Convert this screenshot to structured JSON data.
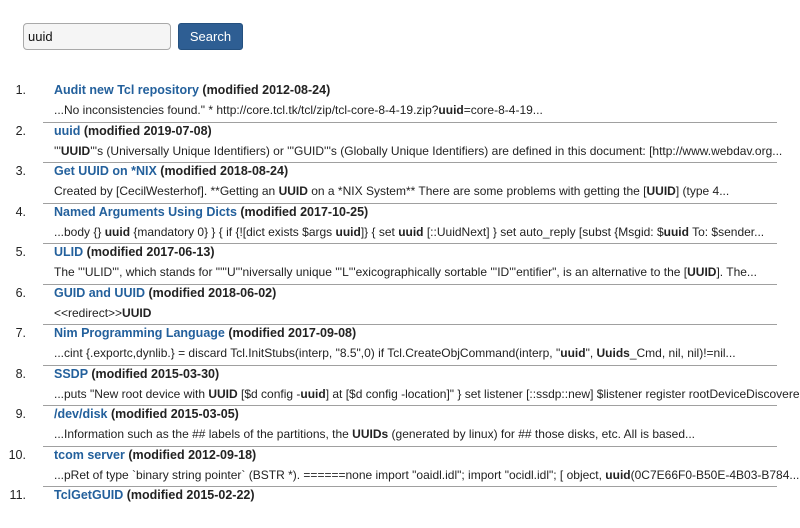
{
  "search": {
    "value": "uuid",
    "button_label": "Search"
  },
  "results": [
    {
      "number": "1.",
      "title": "Audit new Tcl repository",
      "modified": "(modified 2012-08-24)",
      "snippet": [
        {
          "t": "...No inconsistencies found.\" * http://core.tcl.tk/tcl/zip/tcl-core-8-4-19.zip?",
          "b": false
        },
        {
          "t": "uuid",
          "b": true
        },
        {
          "t": "=core-8-4-19...",
          "b": false
        }
      ]
    },
    {
      "number": "2.",
      "title": "uuid",
      "modified": "(modified 2019-07-08)",
      "snippet": [
        {
          "t": "'''",
          "b": false
        },
        {
          "t": "UUID",
          "b": true
        },
        {
          "t": "'''s (Universally Unique Identifiers) or '''GUID'''s (Globally Unique Identifiers) are defined in this document: [http://www.webdav.org...",
          "b": false
        }
      ]
    },
    {
      "number": "3.",
      "title": "Get UUID on *NIX",
      "modified": "(modified 2018-08-24)",
      "snippet": [
        {
          "t": "Created by [CecilWesterhof]. **Getting an ",
          "b": false
        },
        {
          "t": "UUID",
          "b": true
        },
        {
          "t": " on a *NIX System** There are some problems with getting the [",
          "b": false
        },
        {
          "t": "UUID",
          "b": true
        },
        {
          "t": "] (type 4...",
          "b": false
        }
      ]
    },
    {
      "number": "4.",
      "title": "Named Arguments Using Dicts",
      "modified": "(modified 2017-10-25)",
      "snippet": [
        {
          "t": "...body {} ",
          "b": false
        },
        {
          "t": "uuid",
          "b": true
        },
        {
          "t": " {mandatory 0} } { if {![dict exists $args ",
          "b": false
        },
        {
          "t": "uuid",
          "b": true
        },
        {
          "t": "]} { set ",
          "b": false
        },
        {
          "t": "uuid",
          "b": true
        },
        {
          "t": " [::UuidNext] } set auto_reply [subst {Msgid: $",
          "b": false
        },
        {
          "t": "uuid",
          "b": true
        },
        {
          "t": " To: $sender...",
          "b": false
        }
      ]
    },
    {
      "number": "5.",
      "title": "ULID",
      "modified": "(modified 2017-06-13)",
      "snippet": [
        {
          "t": "The '''ULID''', which stands for \"'''U'''niversally unique '''L'''exicographically sortable '''ID'''entifier\", is an alternative to the [",
          "b": false
        },
        {
          "t": "UUID",
          "b": true
        },
        {
          "t": "]. The...",
          "b": false
        }
      ]
    },
    {
      "number": "6.",
      "title": "GUID and UUID",
      "modified": "(modified 2018-06-02)",
      "snippet": [
        {
          "t": "<<redirect>>",
          "b": false
        },
        {
          "t": "UUID",
          "b": true
        }
      ]
    },
    {
      "number": "7.",
      "title": "Nim Programming Language",
      "modified": "(modified 2017-09-08)",
      "snippet": [
        {
          "t": "...cint {.exportc,dynlib.} = discard Tcl.InitStubs(interp, \"8.5\",0) if Tcl.CreateObjCommand(interp, \"",
          "b": false
        },
        {
          "t": "uuid",
          "b": true
        },
        {
          "t": "\", ",
          "b": false
        },
        {
          "t": "Uuids",
          "b": true
        },
        {
          "t": "_Cmd, nil, nil)!=nil...",
          "b": false
        }
      ]
    },
    {
      "number": "8.",
      "title": "SSDP",
      "modified": "(modified 2015-03-30)",
      "snippet": [
        {
          "t": "...puts \"New root device with ",
          "b": false
        },
        {
          "t": "UUID",
          "b": true
        },
        {
          "t": " [$d config -",
          "b": false
        },
        {
          "t": "uuid",
          "b": true
        },
        {
          "t": "] at [$d config -location]\" } set listener [::ssdp::new] $listener register rootDeviceDiscoverer...",
          "b": false
        }
      ]
    },
    {
      "number": "9.",
      "title": "/dev/disk",
      "modified": "(modified 2015-03-05)",
      "snippet": [
        {
          "t": "...Information such as the ## labels of the partitions, the ",
          "b": false
        },
        {
          "t": "UUIDs",
          "b": true
        },
        {
          "t": " (generated by linux) for ## those disks, etc. All is based...",
          "b": false
        }
      ]
    },
    {
      "number": "10.",
      "title": "tcom server",
      "modified": "(modified 2012-09-18)",
      "snippet": [
        {
          "t": "...pRet of type `binary string pointer` (BSTR *). ======none import \"oaidl.idl\"; import \"ocidl.idl\"; [ object, ",
          "b": false
        },
        {
          "t": "uuid",
          "b": true
        },
        {
          "t": "(0C7E66F0-B50E-4B03-B784...",
          "b": false
        }
      ]
    },
    {
      "number": "11.",
      "title": "TclGetGUID",
      "modified": "(modified 2015-02-22)",
      "snippet": []
    }
  ]
}
